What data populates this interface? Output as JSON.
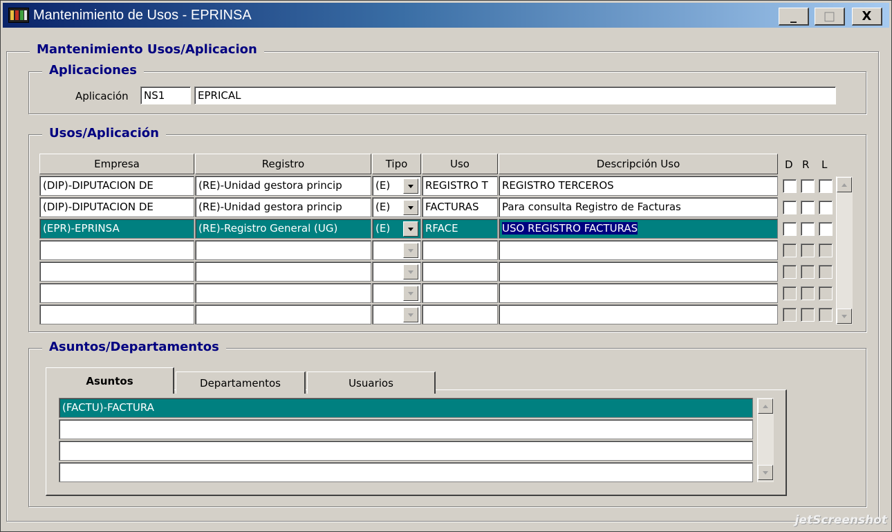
{
  "window": {
    "title": "Mantenimiento de Usos - EPRINSA",
    "minimize": "_",
    "maximize": "□",
    "close": "X"
  },
  "main_group": {
    "title": "Mantenimiento Usos/Aplicacion"
  },
  "aplicaciones": {
    "title": "Aplicaciones",
    "label": "Aplicación",
    "code": "NS1",
    "name": "EPRICAL"
  },
  "usos": {
    "title": "Usos/Aplicación",
    "headers": {
      "empresa": "Empresa",
      "registro": "Registro",
      "tipo": "Tipo",
      "uso": "Uso",
      "descripcion": "Descripción Uso",
      "d": "D",
      "r": "R",
      "l": "L"
    },
    "rows": [
      {
        "empresa": "(DIP)-DIPUTACION DE",
        "registro": "(RE)-Unidad gestora princip",
        "tipo": "(E)",
        "uso": "REGISTRO T",
        "descripcion": "REGISTRO TERCEROS"
      },
      {
        "empresa": "(DIP)-DIPUTACION DE",
        "registro": "(RE)-Unidad gestora princip",
        "tipo": "(E)",
        "uso": "FACTURAS",
        "descripcion": "Para consulta Registro de Facturas"
      },
      {
        "empresa": "(EPR)-EPRINSA",
        "registro": "(RE)-Registro General (UG)",
        "tipo": "(E)",
        "uso": "RFACE",
        "descripcion": "USO REGISTRO FACTURAS"
      }
    ]
  },
  "asuntos": {
    "title": "Asuntos/Departamentos",
    "tabs": [
      "Asuntos",
      "Departamentos",
      "Usuarios"
    ],
    "items": [
      "(FACTU)-FACTURA"
    ]
  },
  "watermark": "jetScreenshot",
  "colors": {
    "selection": "#008080",
    "highlight": "#000080",
    "group_title": "#000080",
    "face": "#d4d0c8"
  }
}
